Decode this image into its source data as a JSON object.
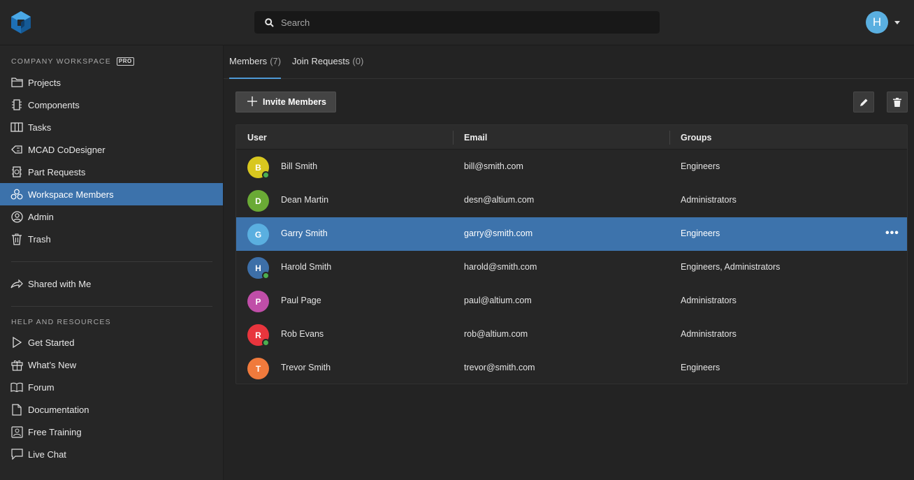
{
  "search": {
    "placeholder": "Search"
  },
  "user_avatar": {
    "initial": "H"
  },
  "sidebar": {
    "workspace_title": "COMPANY WORKSPACE",
    "badge": "PRO",
    "items": [
      {
        "label": "Projects",
        "icon": "folder-icon"
      },
      {
        "label": "Components",
        "icon": "chip-icon"
      },
      {
        "label": "Tasks",
        "icon": "book-icon"
      },
      {
        "label": "MCAD CoDesigner",
        "icon": "mcad-icon"
      },
      {
        "label": "Part Requests",
        "icon": "part-request-icon"
      },
      {
        "label": "Workspace Members",
        "icon": "members-icon"
      },
      {
        "label": "Admin",
        "icon": "user-circle-icon"
      },
      {
        "label": "Trash",
        "icon": "trash-icon"
      }
    ],
    "shared": {
      "label": "Shared with Me",
      "icon": "share-icon"
    },
    "help_title": "HELP AND RESOURCES",
    "help_items": [
      {
        "label": "Get Started",
        "icon": "play-icon"
      },
      {
        "label": "What’s New",
        "icon": "gift-icon"
      },
      {
        "label": "Forum",
        "icon": "book-open-icon"
      },
      {
        "label": "Documentation",
        "icon": "document-icon"
      },
      {
        "label": "Free Training",
        "icon": "training-icon"
      },
      {
        "label": "Live Chat",
        "icon": "chat-icon"
      }
    ]
  },
  "tabs": [
    {
      "label": "Members",
      "count": "(7)"
    },
    {
      "label": "Join Requests",
      "count": "(0)"
    }
  ],
  "toolbar": {
    "invite_label": "Invite Members"
  },
  "table": {
    "columns": [
      "User",
      "Email",
      "Groups"
    ],
    "rows": [
      {
        "initial": "B",
        "name": "Bill Smith",
        "email": "bill@smith.com",
        "groups": "Engineers",
        "color": "#d8c71f",
        "online": true
      },
      {
        "initial": "D",
        "name": "Dean Martin",
        "email": "desn@altium.com",
        "groups": "Administrators",
        "color": "#6aaa35",
        "online": false
      },
      {
        "initial": "G",
        "name": "Garry Smith",
        "email": "garry@smith.com",
        "groups": "Engineers",
        "color": "#5aafe0",
        "online": false
      },
      {
        "initial": "H",
        "name": "Harold Smith",
        "email": "harold@smith.com",
        "groups": "Engineers, Administrators",
        "color": "#3d6fa8",
        "online": true
      },
      {
        "initial": "P",
        "name": "Paul Page",
        "email": "paul@altium.com",
        "groups": "Administrators",
        "color": "#c04ea8",
        "online": false
      },
      {
        "initial": "R",
        "name": "Rob Evans",
        "email": "rob@altium.com",
        "groups": "Administrators",
        "color": "#e8353d",
        "online": true
      },
      {
        "initial": "T",
        "name": "Trevor Smith",
        "email": "trevor@smith.com",
        "groups": "Engineers",
        "color": "#f07a3c",
        "online": false
      }
    ],
    "more_label": "•••"
  }
}
